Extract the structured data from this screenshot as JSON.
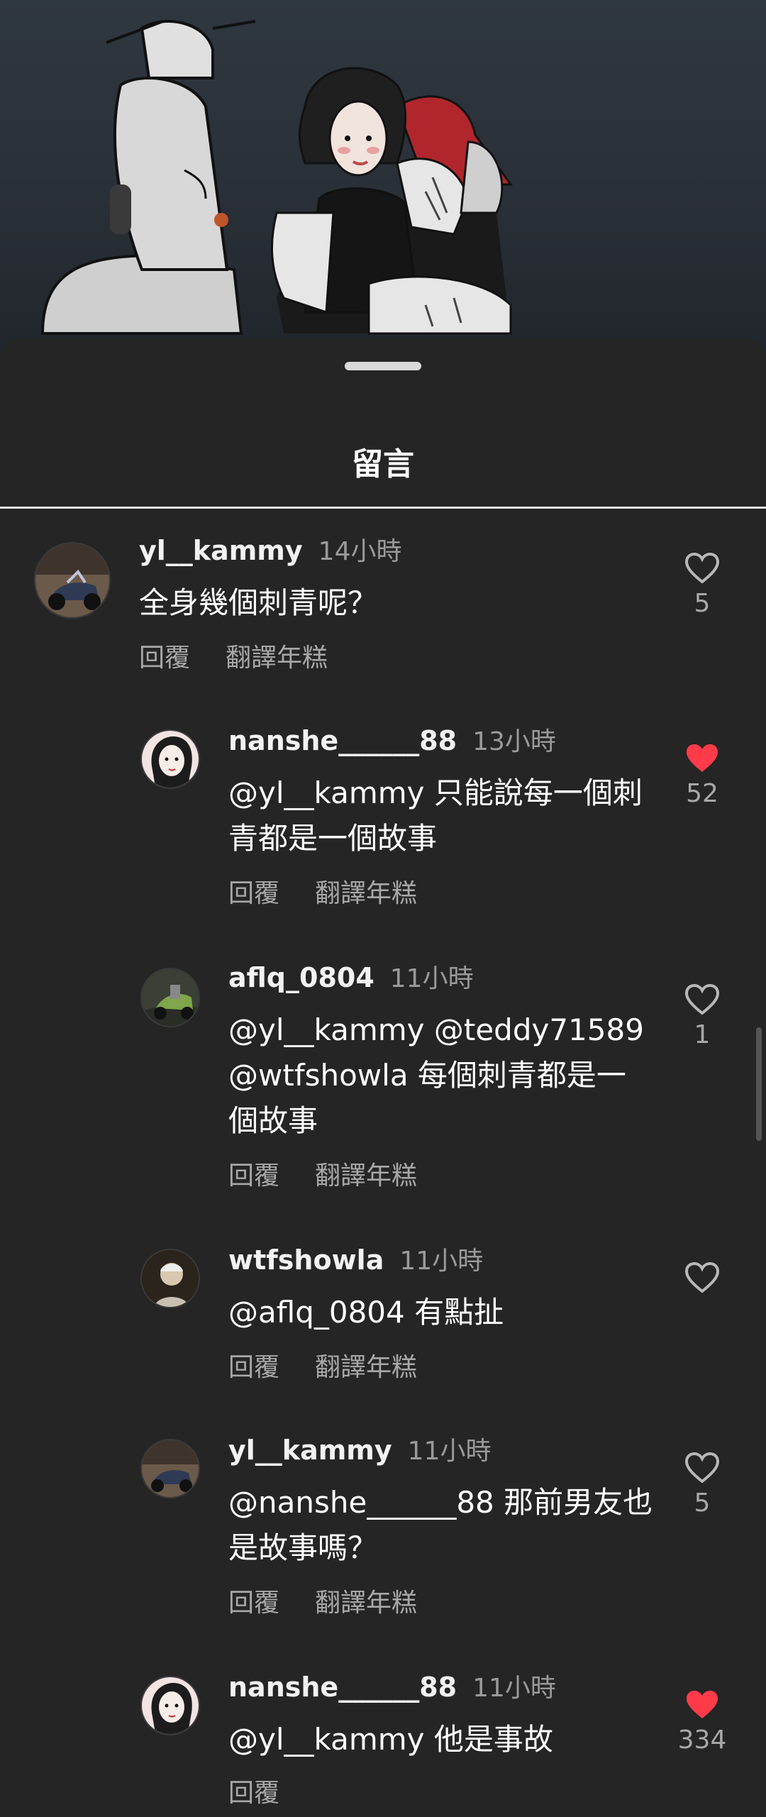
{
  "sheet": {
    "title": "留言"
  },
  "colors": {
    "background": "#242424",
    "liked": "#ff3b4a",
    "muted": "#9a9a9a"
  },
  "comments": [
    {
      "username": "yl__kammy",
      "time": "14小時",
      "text": "全身幾個刺青呢？",
      "reply_label": "回覆",
      "translate_label": "翻譯年糕",
      "likes": "5",
      "liked": false,
      "avatar": "motorcycle-avatar"
    },
    {
      "username": "nanshe______88",
      "time": "13小時",
      "text": "@yl__kammy 只能說每一個刺青都是一個故事",
      "reply_label": "回覆",
      "translate_label": "翻譯年糕",
      "likes": "52",
      "liked": true,
      "avatar": "girl-avatar"
    },
    {
      "username": "aflq_0804",
      "time": "11小時",
      "text": "@yl__kammy @teddy71589 @wtfshowla 每個刺青都是一個故事",
      "reply_label": "回覆",
      "translate_label": "翻譯年糕",
      "likes": "1",
      "liked": false,
      "avatar": "bike-avatar"
    },
    {
      "username": "wtfshowla",
      "time": "11小時",
      "text": "@aflq_0804 有點扯",
      "reply_label": "回覆",
      "translate_label": "翻譯年糕",
      "likes": "",
      "liked": false,
      "avatar": "person-avatar"
    },
    {
      "username": "yl__kammy",
      "time": "11小時",
      "text": "@nanshe______88 那前男友也是故事嗎？",
      "reply_label": "回覆",
      "translate_label": "翻譯年糕",
      "likes": "5",
      "liked": false,
      "avatar": "motorcycle-avatar"
    },
    {
      "username": "nanshe______88",
      "time": "11小時",
      "text": "@yl__kammy 他是事故",
      "reply_label": "回覆",
      "likes": "334",
      "liked": true,
      "avatar": "girl-avatar"
    }
  ]
}
